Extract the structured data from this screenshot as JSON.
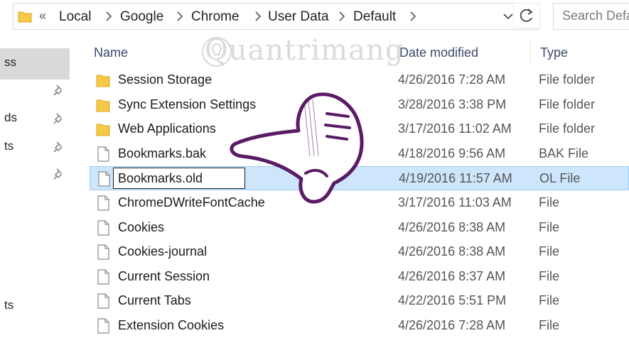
{
  "address_bar": {
    "overflow_chevron": "«",
    "breadcrumbs": [
      "Local",
      "Google",
      "Chrome",
      "User Data",
      "Default"
    ],
    "folder_icon": "folder-icon",
    "dropdown_icon": "chevron-down-icon",
    "refresh_icon": "refresh-icon"
  },
  "search": {
    "placeholder": "Search Default"
  },
  "nav": {
    "items": [
      {
        "label": "ss",
        "selected": true
      },
      {
        "label": "ds",
        "pinned": true
      },
      {
        "label": "ts",
        "pinned": true
      },
      {
        "label": "ts",
        "pinned": false
      }
    ],
    "pins": 4
  },
  "columns": {
    "name": "Name",
    "date": "Date modified",
    "type": "Type"
  },
  "watermark": "Quantrimang",
  "files": [
    {
      "name": "Session Storage",
      "date": "4/26/2016 7:28 AM",
      "type": "File folder",
      "kind": "folder"
    },
    {
      "name": "Sync Extension Settings",
      "date": "3/28/2016 3:38 PM",
      "type": "File folder",
      "kind": "folder"
    },
    {
      "name": "Web Applications",
      "date": "3/17/2016 11:02 AM",
      "type": "File folder",
      "kind": "folder"
    },
    {
      "name": "Bookmarks.bak",
      "date": "4/18/2016 9:56 AM",
      "type": "BAK File",
      "kind": "file"
    },
    {
      "name": "Bookmarks.old",
      "date": "4/19/2016 11:57 AM",
      "type": "OL File",
      "kind": "file",
      "renaming": true
    },
    {
      "name": "ChromeDWriteFontCache",
      "date": "3/17/2016 11:03 AM",
      "type": "File",
      "kind": "file"
    },
    {
      "name": "Cookies",
      "date": "4/26/2016 8:38 AM",
      "type": "File",
      "kind": "file"
    },
    {
      "name": "Cookies-journal",
      "date": "4/26/2016 8:38 AM",
      "type": "File",
      "kind": "file"
    },
    {
      "name": "Current Session",
      "date": "4/26/2016 8:37 AM",
      "type": "File",
      "kind": "file"
    },
    {
      "name": "Current Tabs",
      "date": "4/22/2016 5:51 PM",
      "type": "File",
      "kind": "file"
    },
    {
      "name": "Extension Cookies",
      "date": "4/26/2016 7:28 AM",
      "type": "File",
      "kind": "file"
    }
  ],
  "colors": {
    "selection": "#cde6fb",
    "folder": "#f7c948",
    "annotation": "#5a1a66"
  }
}
